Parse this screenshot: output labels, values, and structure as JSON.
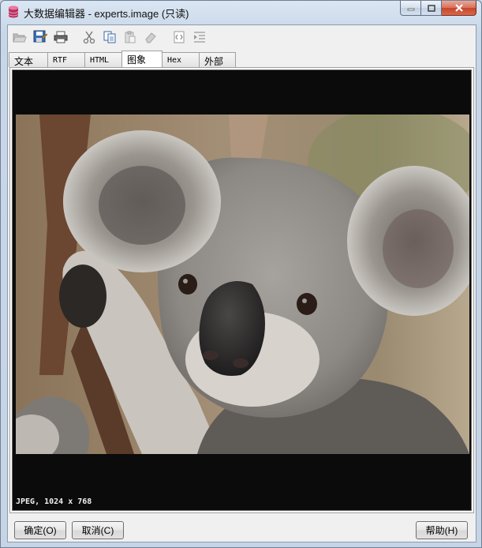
{
  "window": {
    "title": "大数据编辑器 - experts.image (只读)",
    "app_icon": "database-icon"
  },
  "caption_buttons": [
    "minimize-icon",
    "maximize-icon",
    "close-icon"
  ],
  "toolbar": {
    "items": [
      "open-icon",
      "save-icon",
      "print-icon",
      "cut-icon",
      "copy-icon",
      "paste-icon",
      "erase-icon",
      "edit-code-icon",
      "indent-icon"
    ]
  },
  "tabs": [
    {
      "label": "文本",
      "active": false
    },
    {
      "label": "RTF",
      "active": false
    },
    {
      "label": "HTML",
      "active": false
    },
    {
      "label": "图象",
      "active": true
    },
    {
      "label": "Hex",
      "active": false
    },
    {
      "label": "外部",
      "active": false
    }
  ],
  "image_viewer": {
    "subject": "koala photograph",
    "info": "JPEG, 1024 x 768"
  },
  "buttons": {
    "ok": "确定(O)",
    "cancel": "取消(C)",
    "help": "帮助(H)"
  },
  "colors": {
    "viewer_background": "#0b0b0b",
    "titlebar": "#c8d7e8",
    "close_button": "#c7452a"
  }
}
